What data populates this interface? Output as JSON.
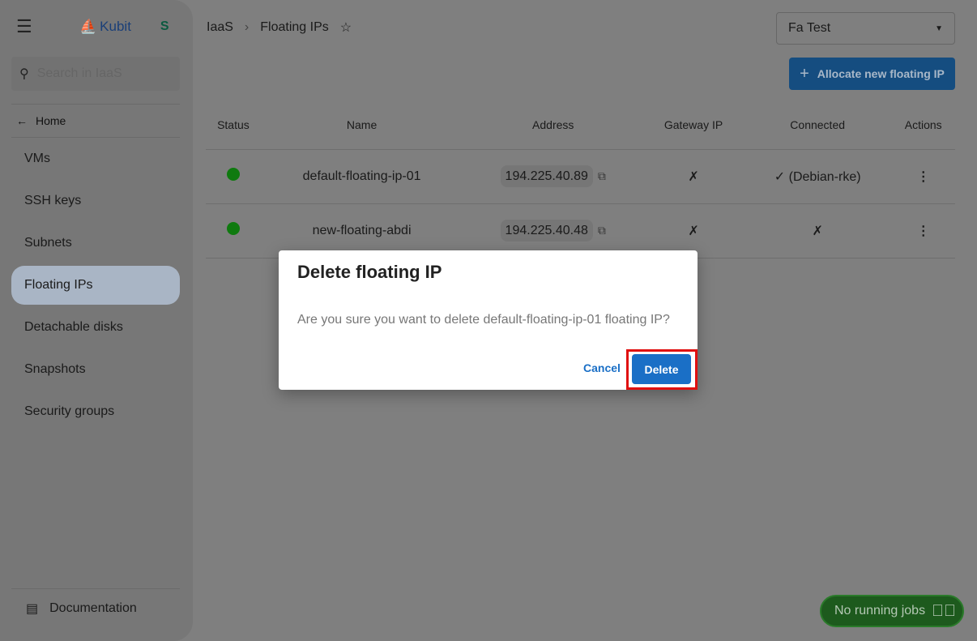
{
  "sidebar": {
    "brand": "Kubit",
    "partner_logo": "S",
    "search_placeholder": "Search in IaaS",
    "home": "Home",
    "items": [
      {
        "label": "VMs"
      },
      {
        "label": "SSH keys"
      },
      {
        "label": "Subnets"
      },
      {
        "label": "Floating IPs",
        "active": true
      },
      {
        "label": "Detachable disks"
      },
      {
        "label": "Snapshots"
      },
      {
        "label": "Security groups"
      }
    ],
    "documentation": "Documentation"
  },
  "breadcrumb": {
    "root": "IaaS",
    "current": "Floating IPs"
  },
  "project_select": {
    "value": "Fa Test"
  },
  "allocate_button": "Allocate new floating IP",
  "table": {
    "headers": [
      "Status",
      "Name",
      "Address",
      "Gateway IP",
      "Connected",
      "Actions"
    ],
    "rows": [
      {
        "status": "active",
        "name": "default-floating-ip-01",
        "address": "194.225.40.89",
        "gateway": "✗",
        "connected": "✓ (Debian-rke)"
      },
      {
        "status": "active",
        "name": "new-floating-abdi",
        "address": "194.225.40.48",
        "gateway": "✗",
        "connected": "✗"
      }
    ]
  },
  "dialog": {
    "title": "Delete floating IP",
    "message": "Are you sure you want to delete default-floating-ip-01 floating IP?",
    "cancel": "Cancel",
    "delete": "Delete"
  },
  "jobs": {
    "label": "No running jobs"
  },
  "colors": {
    "primary": "#1a6fc6",
    "status_ok": "#0f7a0f",
    "highlight": "#e01010"
  }
}
